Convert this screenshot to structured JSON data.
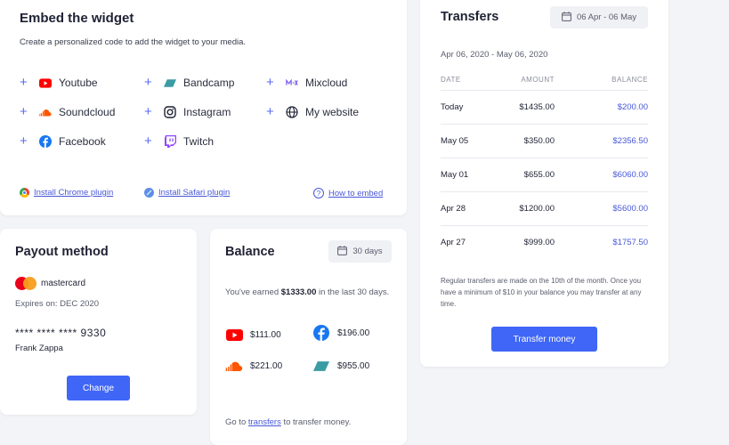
{
  "embed": {
    "title": "Embed the widget",
    "subtitle": "Create a personalized code to add the widget to your media.",
    "services": [
      {
        "label": "Youtube",
        "icon": "youtube-icon"
      },
      {
        "label": "Bandcamp",
        "icon": "bandcamp-icon"
      },
      {
        "label": "Mixcloud",
        "icon": "mixcloud-icon"
      },
      {
        "label": "Soundcloud",
        "icon": "soundcloud-icon"
      },
      {
        "label": "Instagram",
        "icon": "instagram-icon"
      },
      {
        "label": "My website",
        "icon": "globe-icon"
      },
      {
        "label": "Facebook",
        "icon": "facebook-icon"
      },
      {
        "label": "Twitch",
        "icon": "twitch-icon"
      }
    ],
    "links": {
      "chrome": "Install Chrome plugin",
      "safari": "Install Safari plugin",
      "how": "How to embed"
    }
  },
  "payout": {
    "title": "Payout method",
    "card_brand": "mastercard",
    "expires": "Expires on: DEC 2020",
    "card_number": "**** **** **** 9330",
    "holder": "Frank Zappa",
    "change_label": "Change"
  },
  "balance": {
    "title": "Balance",
    "period": "30 days",
    "earned_prefix": "You've earned ",
    "earned_amount": "$1333.00",
    "earned_suffix": " in the last 30 days.",
    "items": [
      {
        "icon": "youtube-icon",
        "amount": "$111.00"
      },
      {
        "icon": "facebook-icon",
        "amount": "$196.00"
      },
      {
        "icon": "soundcloud-icon",
        "amount": "$221.00"
      },
      {
        "icon": "bandcamp-icon",
        "amount": "$955.00"
      }
    ],
    "goto_prefix": "Go to ",
    "goto_link": "transfers",
    "goto_suffix": " to transfer money."
  },
  "transfers": {
    "title": "Transfers",
    "date_pill": "06 Apr - 06 May",
    "range": "Apr 06, 2020 - May 06, 2020",
    "columns": {
      "date": "DATE",
      "amount": "AMOUNT",
      "balance": "BALANCE"
    },
    "rows": [
      {
        "date": "Today",
        "amount": "$1435.00",
        "balance": "$200.00"
      },
      {
        "date": "May 05",
        "amount": "$350.00",
        "balance": "$2356.50"
      },
      {
        "date": "May 01",
        "amount": "$655.00",
        "balance": "$6060.00"
      },
      {
        "date": "Apr 28",
        "amount": "$1200.00",
        "balance": "$5600.00"
      },
      {
        "date": "Apr 27",
        "amount": "$999.00",
        "balance": "$1757.50"
      }
    ],
    "note": "Regular transfers are made on the 10th of the month. Once you have a minimum of $10 in your balance you may transfer at any time.",
    "button_label": "Transfer money"
  },
  "colors": {
    "accent": "#3f66f6",
    "link": "#4758d8",
    "youtube": "#ff0000",
    "soundcloud": "#ff5500",
    "facebook": "#1877f2",
    "bandcamp": "#3b9ca3",
    "twitch": "#9146ff"
  }
}
